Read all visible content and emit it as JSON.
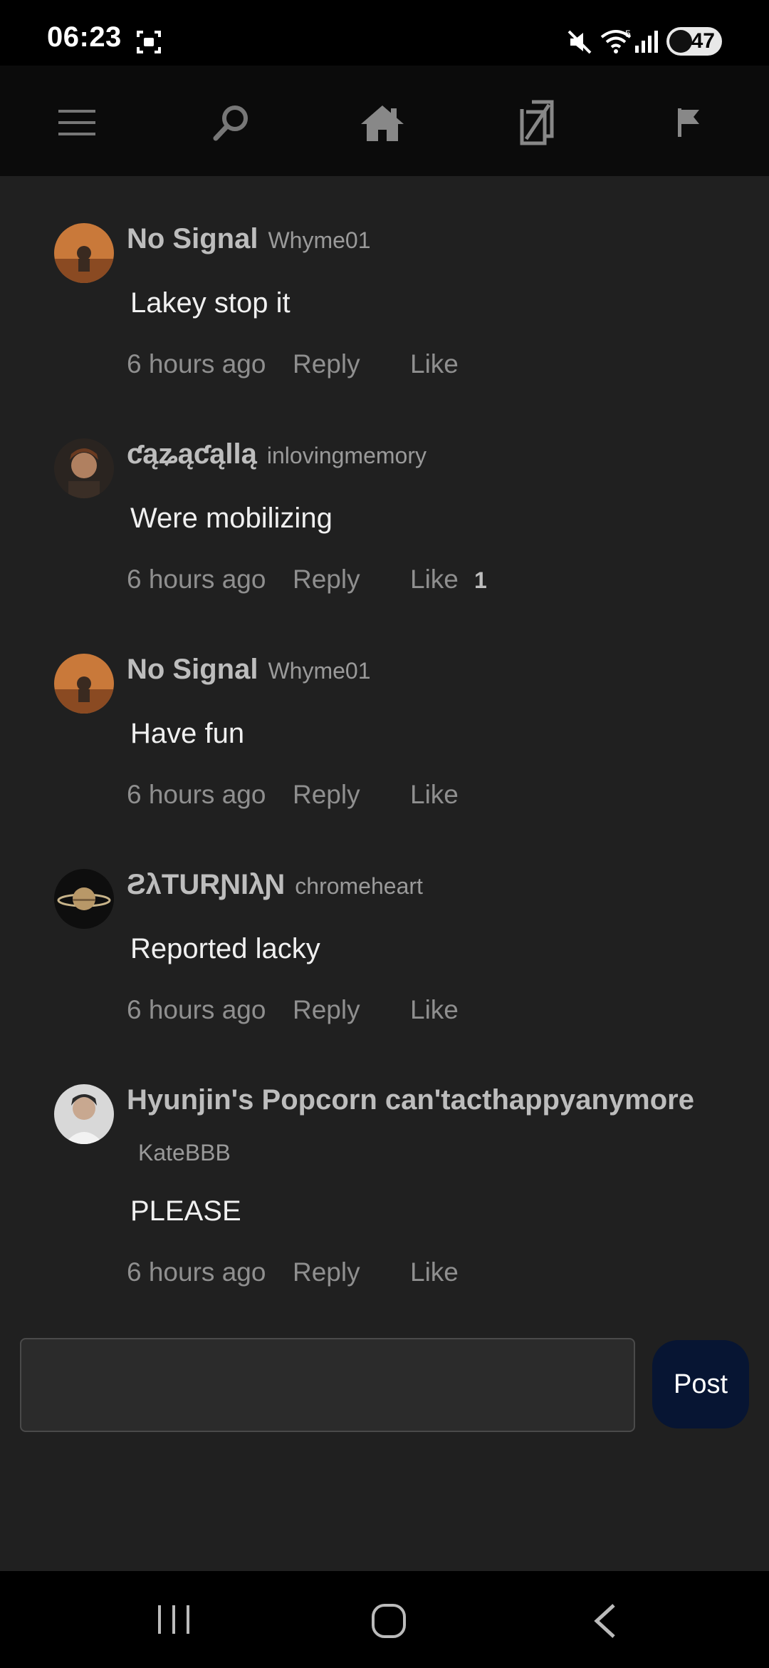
{
  "status_bar": {
    "time": "06:23",
    "battery": "47",
    "icons": [
      "screenshot-icon",
      "mute-icon",
      "wifi-icon",
      "signal-icon",
      "battery-icon"
    ]
  },
  "top_nav": {
    "items": [
      "menu-icon",
      "search-icon",
      "home-icon",
      "library-icon",
      "flag-icon"
    ]
  },
  "comments": [
    {
      "display_name": "No Signal",
      "username": "Whyme01",
      "text": "Lakey stop it",
      "time": "6 hours ago",
      "reply": "Reply",
      "like": "Like",
      "like_count": ""
    },
    {
      "display_name": "ƈąʑąƈąllą",
      "username": "inlovingmemory",
      "text": "Were mobilizing",
      "time": "6 hours ago",
      "reply": "Reply",
      "like": "Like",
      "like_count": "1"
    },
    {
      "display_name": "No Signal",
      "username": "Whyme01",
      "text": "Have fun",
      "time": "6 hours ago",
      "reply": "Reply",
      "like": "Like",
      "like_count": ""
    },
    {
      "display_name": "ƧλTURƝIλƝ",
      "username": "chromeheart",
      "text": "Reported lacky",
      "time": "6 hours ago",
      "reply": "Reply",
      "like": "Like",
      "like_count": ""
    },
    {
      "display_name": "Hyunjin's Popcorn can'tacthappyanymore",
      "username": "KateBBB",
      "text": "PLEASE",
      "time": "6 hours ago",
      "reply": "Reply",
      "like": "Like",
      "like_count": ""
    }
  ],
  "composer": {
    "placeholder": "",
    "post_label": "Post"
  },
  "colors": {
    "background": "#202020",
    "post_button": "#071533"
  }
}
